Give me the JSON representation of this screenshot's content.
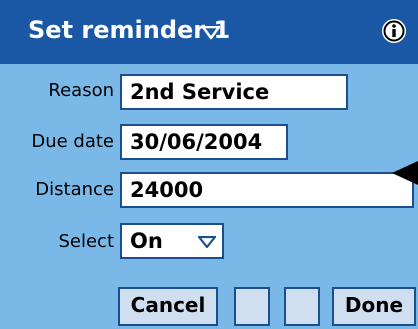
{
  "dialog": {
    "title": "Set reminder 1",
    "title_menu_icon": "down-triangle-icon",
    "info_icon": "info-icon"
  },
  "form": {
    "reason": {
      "label": "Reason",
      "value": "2nd Service"
    },
    "due_date": {
      "label": "Due date",
      "value": "30/06/2004"
    },
    "distance": {
      "label": "Distance",
      "value": "24000"
    },
    "select": {
      "label": "Select",
      "value": "On"
    }
  },
  "buttons": {
    "cancel": "Cancel",
    "done": "Done"
  },
  "colors": {
    "titlebar": "#1a58a6",
    "background": "#7ab8e8",
    "border": "#1a4f8f"
  }
}
